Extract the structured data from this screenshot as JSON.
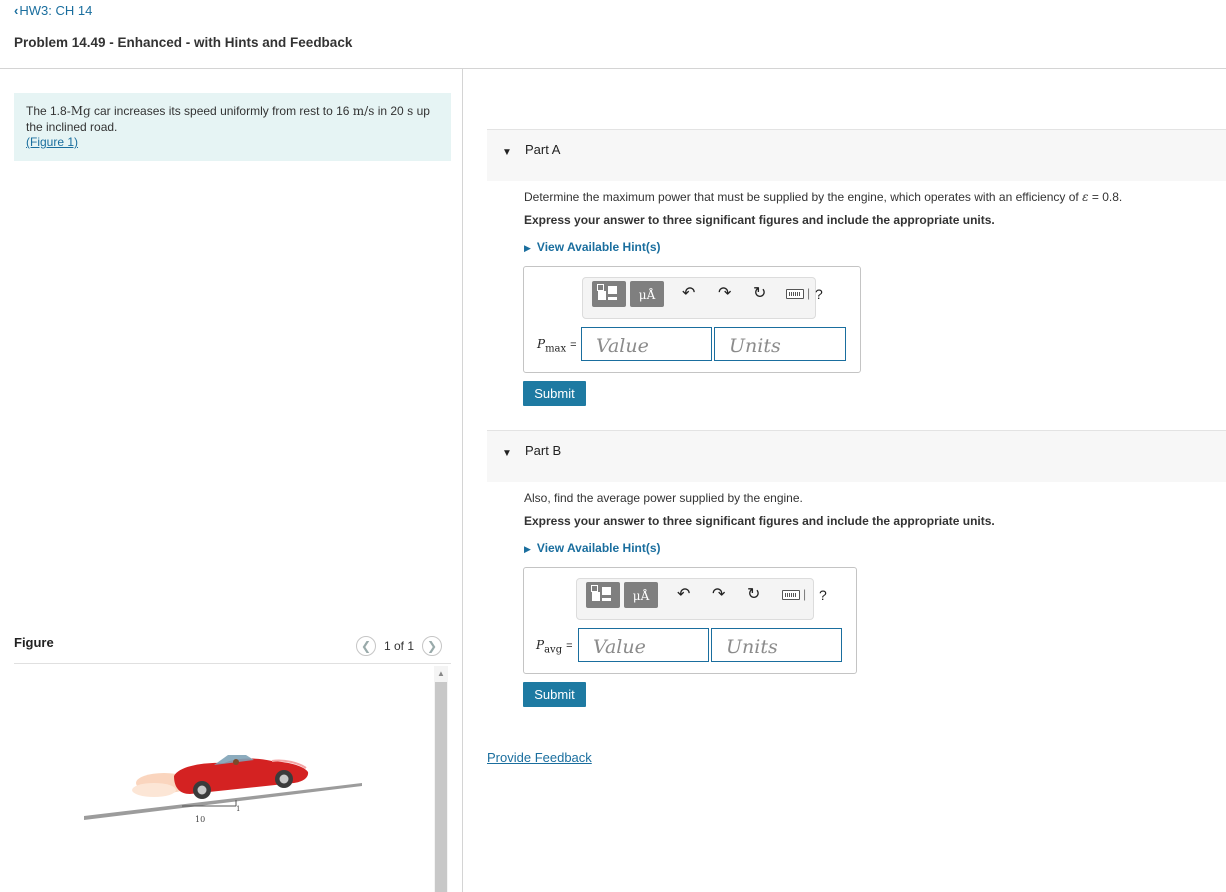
{
  "header": {
    "back_link": "HW3: CH 14",
    "problem_title": "Problem 14.49 - Enhanced - with Hints and Feedback"
  },
  "statement": {
    "text_1": "The 1.8-",
    "unit_mg": "Mg",
    "text_2": " car increases its speed uniformly from rest to 16 ",
    "unit_ms": "m/s",
    "text_3": " in 20 ",
    "unit_s": "s",
    "text_4": " up the inclined road.",
    "figure_link": "(Figure 1)"
  },
  "figure": {
    "label": "Figure",
    "counter": "1 of 1",
    "prev_icon": "chevron-left-icon",
    "next_icon": "chevron-right-icon",
    "slope_run": "10",
    "slope_rise": "1"
  },
  "part_a": {
    "title": "Part A",
    "question_1": "Determine the maximum power that must be supplied by the engine, which operates with an efficiency of ",
    "epsilon": "ε",
    "question_2": " = 0.8.",
    "instruction": "Express your answer to three significant figures and include the appropriate units.",
    "hint": "View Available Hint(s)",
    "var_main": "P",
    "var_sub": "max",
    "equals": "=",
    "value_placeholder": "Value",
    "units_placeholder": "Units",
    "submit": "Submit"
  },
  "part_b": {
    "title": "Part B",
    "question": "Also, find the average power supplied by the engine.",
    "instruction": "Express your answer to three significant figures and include the appropriate units.",
    "hint": "View Available Hint(s)",
    "var_main": "P",
    "var_sub": "avg",
    "equals": "=",
    "value_placeholder": "Value",
    "units_placeholder": "Units",
    "submit": "Submit"
  },
  "toolbar": {
    "templates_icon": "templates-icon",
    "units_btn": "μÅ",
    "undo_icon": "undo-icon",
    "redo_icon": "redo-icon",
    "reset_icon": "reset-icon",
    "keyboard_icon": "keyboard-icon",
    "help": "?"
  },
  "feedback": "Provide Feedback"
}
